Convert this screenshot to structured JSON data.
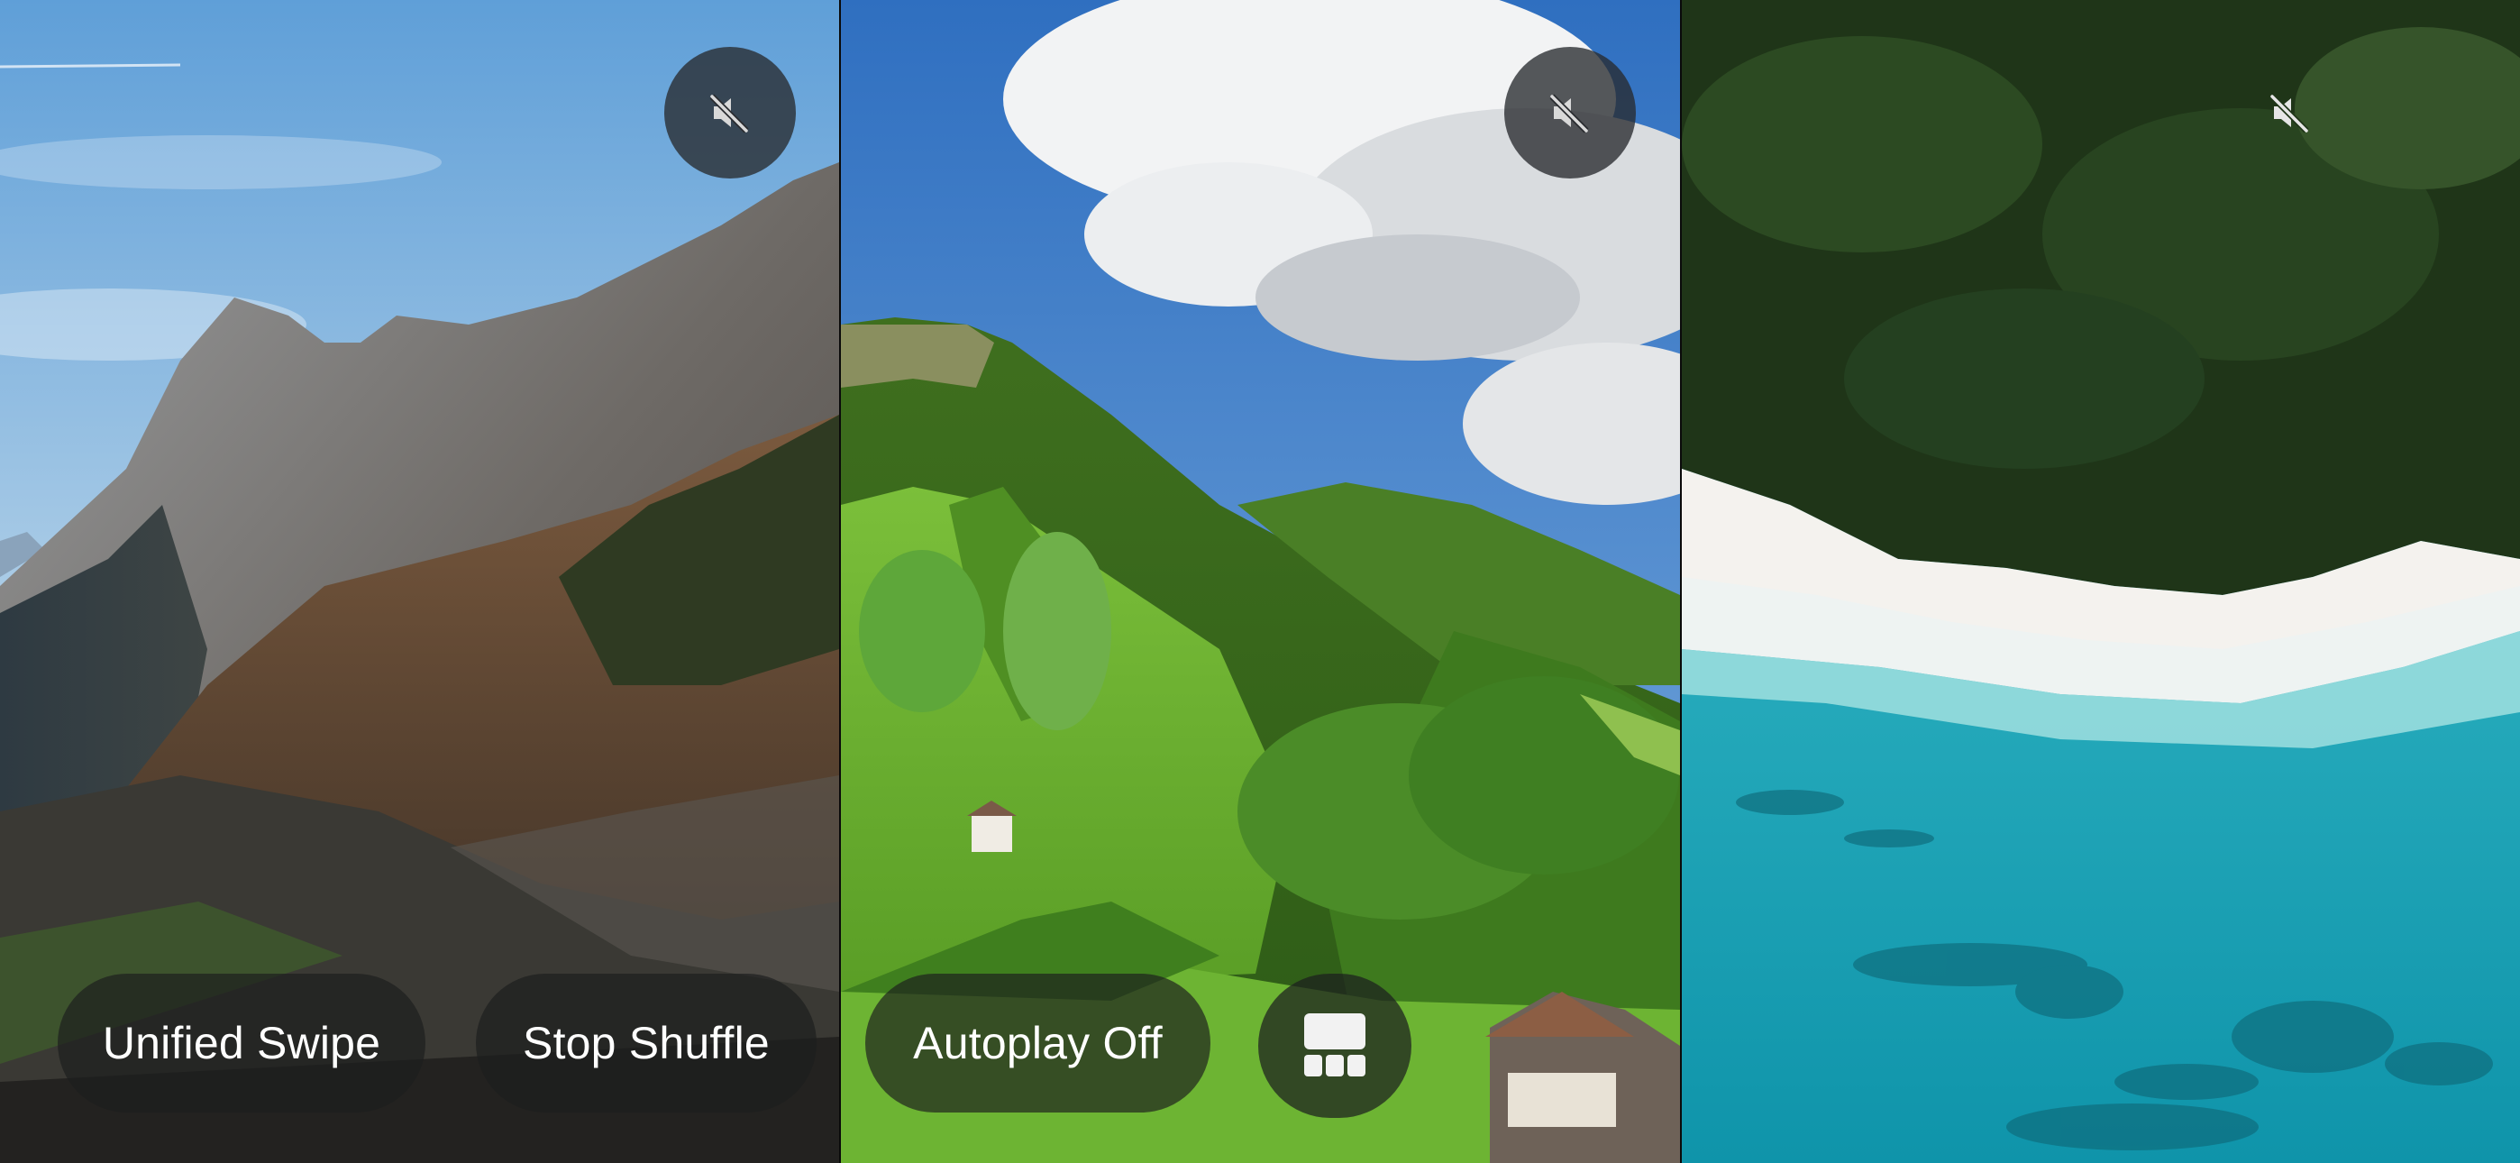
{
  "panels": [
    {
      "name": "mountain-cliff-video",
      "mute_icon": "speaker-muted-icon"
    },
    {
      "name": "green-valley-video",
      "mute_icon": "speaker-muted-icon"
    },
    {
      "name": "tropical-beach-video",
      "mute_icon": "speaker-muted-icon"
    }
  ],
  "controls": {
    "unified_swipe_label": "Unified Swipe",
    "stop_shuffle_label": "Stop Shuffle",
    "autoplay_label": "Autoplay Off",
    "layout_icon": "grid-layout-icon"
  },
  "colors": {
    "button_bg": "#1c1e1e",
    "button_text": "#ffffff",
    "mute_bg": "#2a2c30"
  }
}
